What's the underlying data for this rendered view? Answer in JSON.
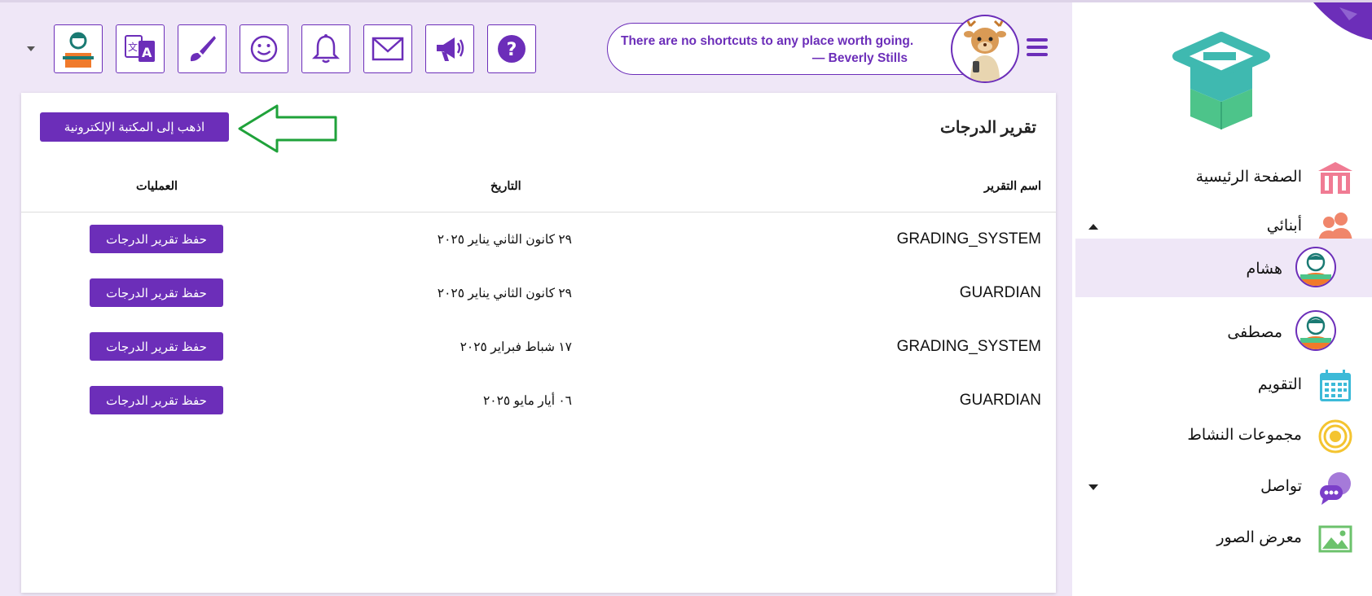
{
  "header": {
    "quote_text": "There are no shortcuts to any place worth going.",
    "quote_author": "— Beverly Stills",
    "icons": [
      "user-avatar-icon",
      "translate-icon",
      "brush-icon",
      "smiley-icon",
      "bell-icon",
      "mail-icon",
      "megaphone-icon",
      "help-icon"
    ]
  },
  "card": {
    "title": "تقرير الدرجات",
    "library_button": "اذهب إلى المكتبة الإلكترونية",
    "columns": {
      "name": "اسم التقرير",
      "date": "التاريخ",
      "ops": "العمليات"
    },
    "rows": [
      {
        "name": "GRADING_SYSTEM",
        "date": "٢٩ كانون الثاني يناير ٢٠٢٥",
        "action": "حفظ تقرير الدرجات"
      },
      {
        "name": "GUARDIAN",
        "date": "٢٩ كانون الثاني يناير ٢٠٢٥",
        "action": "حفظ تقرير الدرجات"
      },
      {
        "name": "GRADING_SYSTEM",
        "date": "١٧ شباط فبراير ٢٠٢٥",
        "action": "حفظ تقرير الدرجات"
      },
      {
        "name": "GUARDIAN",
        "date": "٠٦ أيار مايو ٢٠٢٥",
        "action": "حفظ تقرير الدرجات"
      }
    ]
  },
  "sidebar": {
    "items": [
      {
        "label": "الصفحة الرئيسية",
        "icon": "school-icon"
      },
      {
        "label": "أبنائي",
        "icon": "children-icon"
      },
      {
        "label": "هشام",
        "icon": "child-avatar-icon"
      },
      {
        "label": "مصطفى",
        "icon": "child-avatar-icon"
      },
      {
        "label": "التقويم",
        "icon": "calendar-icon"
      },
      {
        "label": "مجموعات النشاط",
        "icon": "activity-groups-icon"
      },
      {
        "label": "تواصل",
        "icon": "chat-icon"
      },
      {
        "label": "معرض الصور",
        "icon": "gallery-icon"
      }
    ]
  },
  "colors": {
    "accent": "#6c2eb9",
    "background": "#efe7f7",
    "arrow": "#1fa23a"
  }
}
